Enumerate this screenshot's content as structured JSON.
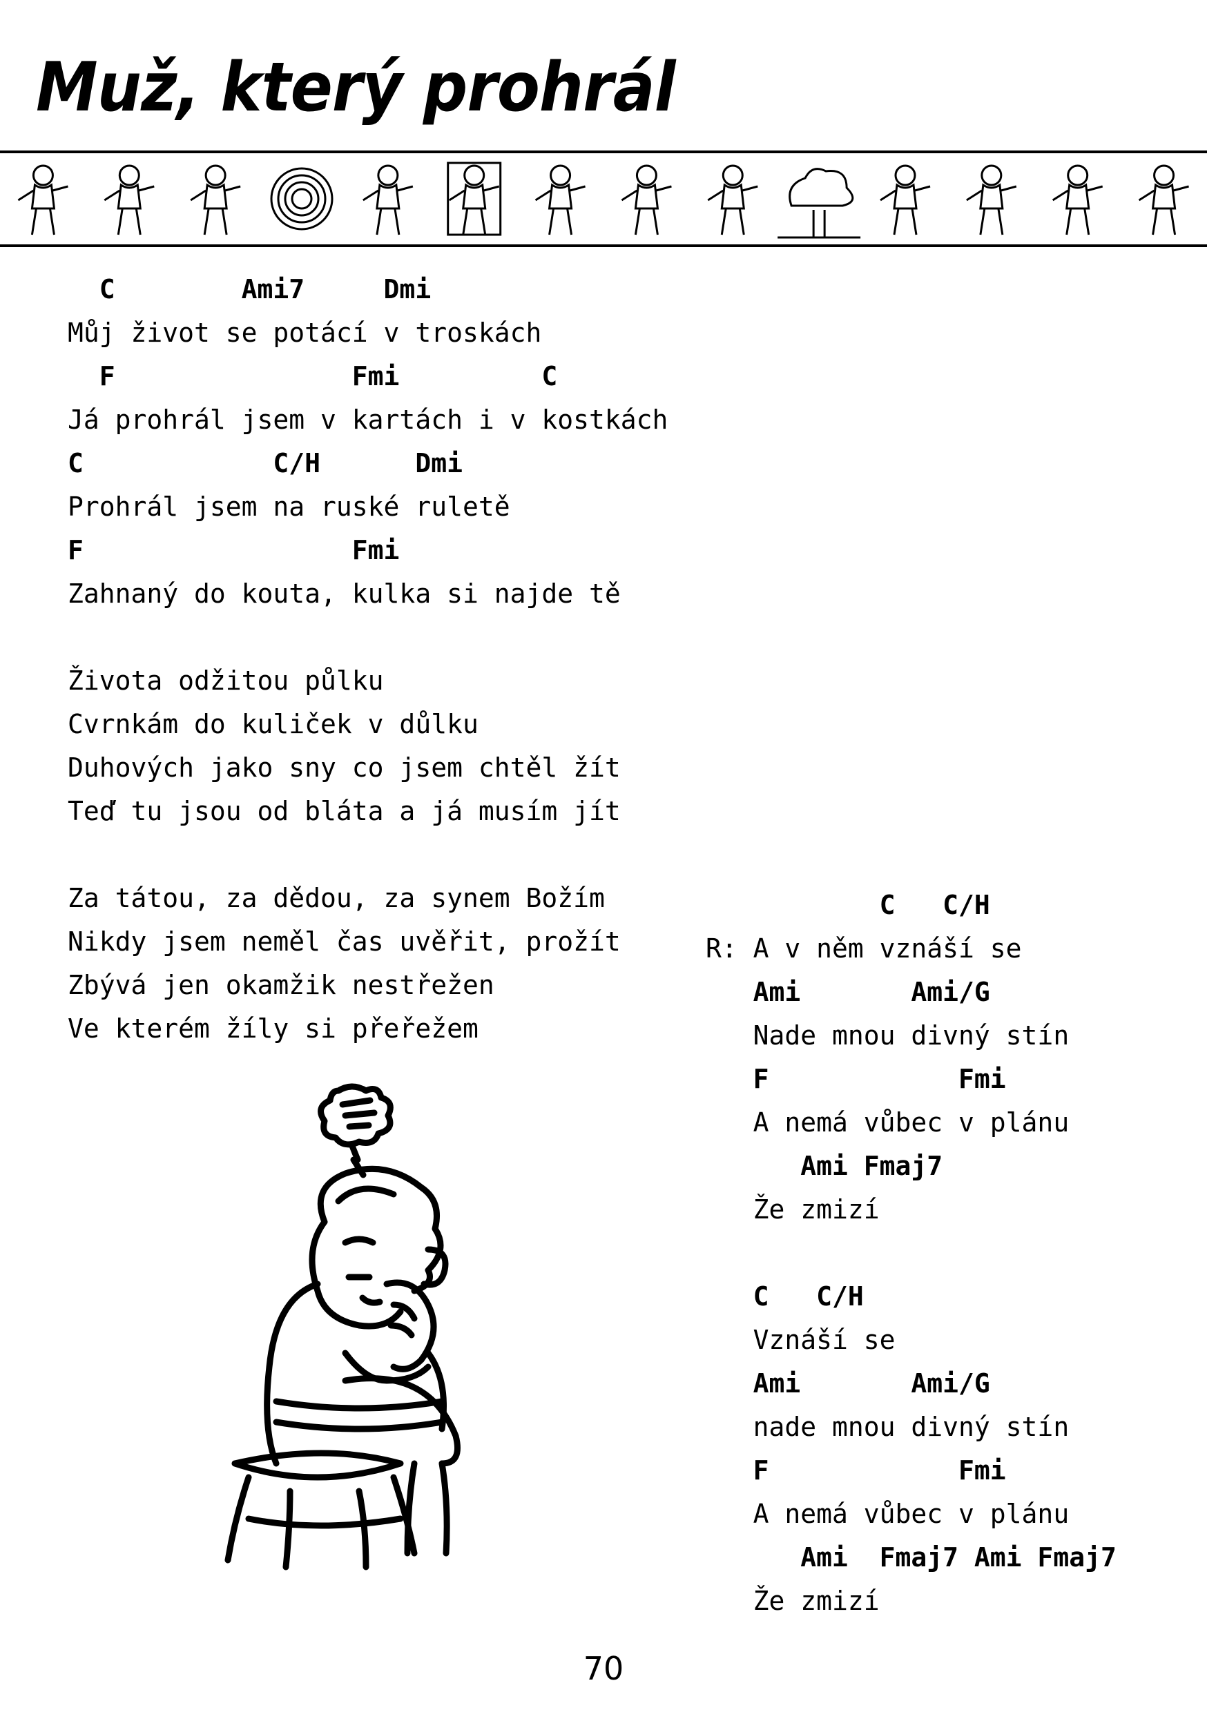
{
  "title": "Muž, který prohrál",
  "page_number": "70",
  "banner": {
    "icons": [
      "vault-boy-pistol-icon",
      "vault-boy-flying-icon",
      "vault-boy-minigun-icon",
      "vault-boy-target-icon",
      "vault-boy-revolver-icon",
      "vault-boy-framed-icon",
      "vault-boy-director-icon",
      "vault-boy-rocket-launcher-icon",
      "vault-boy-carrying-boxes-icon",
      "vault-boy-nuke-cloud-icon",
      "vault-boy-sword-icon",
      "vault-boy-dual-wield-icon",
      "vault-boy-gear-icon",
      "vault-boy-dog-icon"
    ]
  },
  "verse1": {
    "lines": [
      {
        "type": "chord",
        "text": "  C        Ami7     Dmi"
      },
      {
        "type": "lyric",
        "text": "Můj život se potácí v troskách"
      },
      {
        "type": "chord",
        "text": "  F               Fmi         C"
      },
      {
        "type": "lyric",
        "text": "Já prohrál jsem v kartách i v kostkách"
      },
      {
        "type": "chord",
        "text": "C            C/H      Dmi"
      },
      {
        "type": "lyric",
        "text": "Prohrál jsem na ruské ruletě"
      },
      {
        "type": "chord",
        "text": "F                 Fmi"
      },
      {
        "type": "lyric",
        "text": "Zahnaný do kouta, kulka si najde tě"
      },
      {
        "type": "blank",
        "text": ""
      },
      {
        "type": "lyric",
        "text": "Života odžitou půlku"
      },
      {
        "type": "lyric",
        "text": "Cvrnkám do kuliček v důlku"
      },
      {
        "type": "lyric",
        "text": "Duhových jako sny co jsem chtěl žít"
      },
      {
        "type": "lyric",
        "text": "Teď tu jsou od bláta a já musím jít"
      },
      {
        "type": "blank",
        "text": ""
      },
      {
        "type": "lyric",
        "text": "Za tátou, za dědou, za synem Božím"
      },
      {
        "type": "lyric",
        "text": "Nikdy jsem neměl čas uvěřit, prožít"
      },
      {
        "type": "lyric",
        "text": "Zbývá jen okamžik nestřežen"
      },
      {
        "type": "lyric",
        "text": "Ve kterém žíly si přeřežem"
      }
    ]
  },
  "refrain": {
    "lines": [
      {
        "type": "chord",
        "text": "           C   C/H"
      },
      {
        "type": "lyric",
        "text": "R: A v něm vznáší se"
      },
      {
        "type": "chord",
        "text": "   Ami       Ami/G"
      },
      {
        "type": "lyric",
        "text": "   Nade mnou divný stín"
      },
      {
        "type": "chord",
        "text": "   F            Fmi"
      },
      {
        "type": "lyric",
        "text": "   A nemá vůbec v plánu"
      },
      {
        "type": "chord",
        "text": "      Ami Fmaj7"
      },
      {
        "type": "lyric",
        "text": "   Že zmizí"
      },
      {
        "type": "blank",
        "text": ""
      },
      {
        "type": "chord",
        "text": "   C   C/H"
      },
      {
        "type": "lyric",
        "text": "   Vznáší se"
      },
      {
        "type": "chord",
        "text": "   Ami       Ami/G"
      },
      {
        "type": "lyric",
        "text": "   nade mnou divný stín"
      },
      {
        "type": "chord",
        "text": "   F            Fmi"
      },
      {
        "type": "lyric",
        "text": "   A nemá vůbec v plánu"
      },
      {
        "type": "chord",
        "text": "      Ami  Fmaj7 Ami Fmaj7"
      },
      {
        "type": "lyric",
        "text": "   Že zmizí"
      }
    ]
  },
  "illustration": {
    "icon": "sad-vault-boy-sitting-icon"
  }
}
